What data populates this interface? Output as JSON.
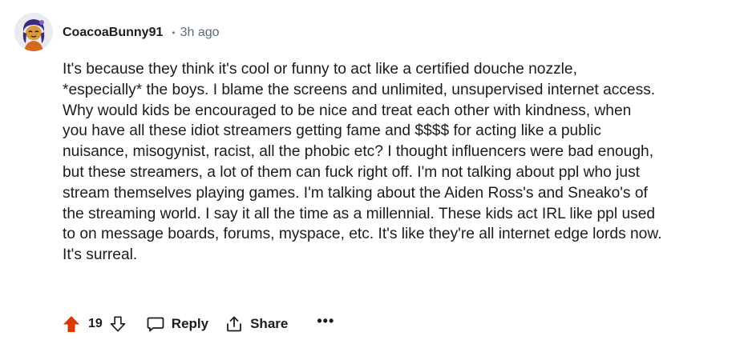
{
  "comment": {
    "author": "CoacoaBunny91",
    "separator": "•",
    "time_ago": "3h ago",
    "body_lines": [
      "It's because they think it's cool or funny to act like a certified douche nozzle,",
      "*especially* the boys. I blame the screens and unlimited, unsupervised internet access.",
      "Why would kids be encouraged to be nice and treat each other with kindness, when",
      "you have all these idiot streamers getting fame and $$$$ for acting like a public",
      "nuisance, misogynist, racist, all the phobic etc? I thought influencers were bad enough,",
      "but these streamers, a lot of them can fuck right off. I'm not talking about ppl who just",
      "stream themselves playing games. I'm talking about the Aiden Ross's and Sneako's of",
      "the streaming world. I say it all the time as a millennial. These kids act IRL like ppl used",
      "to on message boards, forums, myspace, etc. It's like they're all internet edge lords now.",
      "It's surreal."
    ]
  },
  "actions": {
    "score": "19",
    "reply_label": "Reply",
    "share_label": "Share",
    "more_label": "•••"
  },
  "icons": {
    "upvote": "upvote-arrow-icon",
    "downvote": "downvote-arrow-icon",
    "reply": "speech-bubble-icon",
    "share": "share-arrow-icon",
    "more": "ellipsis-icon",
    "avatar": "snoo-avatar"
  },
  "colors": {
    "upvote_active": "#d93a00",
    "avatar_hair": "#3a2a7a",
    "avatar_skin": "#d89a3c",
    "text": "#1c1c1c",
    "muted": "#576f76"
  }
}
